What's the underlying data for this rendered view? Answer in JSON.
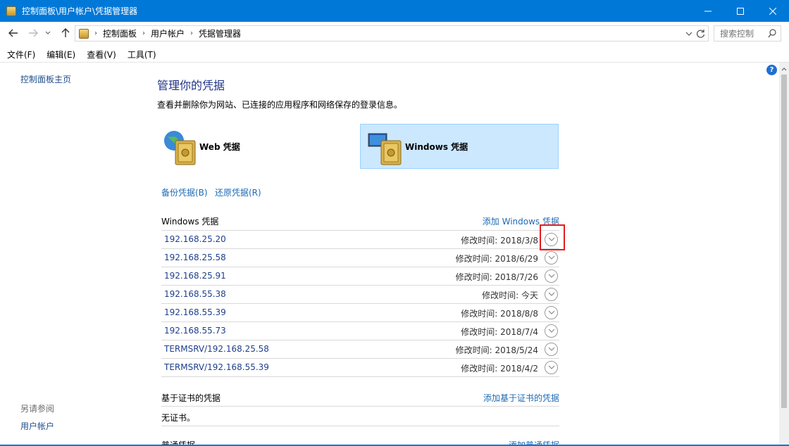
{
  "window": {
    "title": "控制面板\\用户帐户\\凭据管理器",
    "minimize_icon": "minimize-icon",
    "maximize_icon": "maximize-icon",
    "close_icon": "close-icon"
  },
  "address": {
    "breadcrumbs": [
      "控制面板",
      "用户帐户",
      "凭据管理器"
    ],
    "search_placeholder": "搜索控制"
  },
  "menu": [
    "文件(F)",
    "编辑(E)",
    "查看(V)",
    "工具(T)"
  ],
  "left_pane": {
    "home_link": "控制面板主页",
    "see_also_label": "另请参阅",
    "see_also_links": [
      "用户帐户"
    ]
  },
  "main": {
    "title": "管理你的凭据",
    "subtitle": "查看并删除你为网站、已连接的应用程序和网络保存的登录信息。",
    "tiles": {
      "web": "Web 凭据",
      "windows": "Windows 凭据"
    },
    "backup_link": "备份凭据(B)",
    "restore_link": "还原凭据(R)",
    "windows_section": {
      "title": "Windows 凭据",
      "action": "添加 Windows 凭据",
      "rows": [
        {
          "host": "192.168.25.20",
          "modified": "修改时间: 2018/3/8"
        },
        {
          "host": "192.168.25.58",
          "modified": "修改时间: 2018/6/29"
        },
        {
          "host": "192.168.25.91",
          "modified": "修改时间: 2018/7/26"
        },
        {
          "host": "192.168.55.38",
          "modified": "修改时间: 今天"
        },
        {
          "host": "192.168.55.39",
          "modified": "修改时间: 2018/8/8"
        },
        {
          "host": "192.168.55.73",
          "modified": "修改时间: 2018/7/4"
        },
        {
          "host": "TERMSRV/192.168.25.58",
          "modified": "修改时间: 2018/5/24"
        },
        {
          "host": "TERMSRV/192.168.55.39",
          "modified": "修改时间: 2018/4/2"
        }
      ]
    },
    "cert_section": {
      "title": "基于证书的凭据",
      "action": "添加基于证书的凭据",
      "empty": "无证书。"
    },
    "generic_section": {
      "title": "普通凭据",
      "action": "添加普通凭据"
    }
  },
  "colors": {
    "titlebar": "#0078d7",
    "link": "#1e6ab3",
    "highlight": "#e81b1b",
    "selected_tile": "#cce8ff"
  }
}
